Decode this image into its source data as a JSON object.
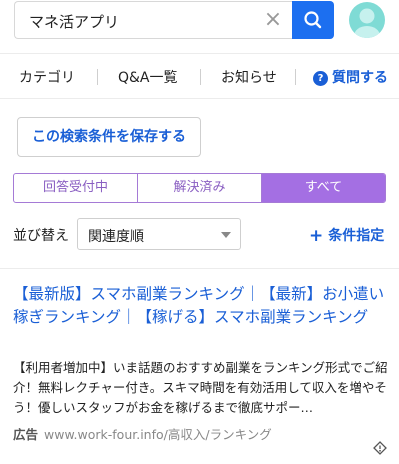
{
  "search": {
    "query": "マネ活アプリ"
  },
  "nav": {
    "items": [
      "カテゴリ",
      "Q&A一覧",
      "お知らせ"
    ],
    "ask_label": "質問する"
  },
  "save_button": "この検索条件を保存する",
  "tabs": {
    "items": [
      "回答受付中",
      "解決済み",
      "すべて"
    ],
    "active_index": 2
  },
  "sort": {
    "label": "並び替え",
    "value": "関連度順"
  },
  "filter_label": "条件指定",
  "ad": {
    "title": "【最新版】スマホ副業ランキング｜【最新】お小遣い稼ぎランキング｜【稼げる】スマホ副業ランキング",
    "description": "【利用者増加中】いま話題のおすすめ副業をランキング形式でご紹介！無料レクチャー付き。スキマ時間を有効活用して収入を増やそう！優しいスタッフがお金を稼げるまで徹底サポー…",
    "badge": "広告",
    "url": "www.work-four.info/高収入/ランキング"
  },
  "colors": {
    "accent_blue": "#1c6ff0",
    "tab_purple": "#a46fe3",
    "avatar_teal": "#7fdbd5"
  }
}
